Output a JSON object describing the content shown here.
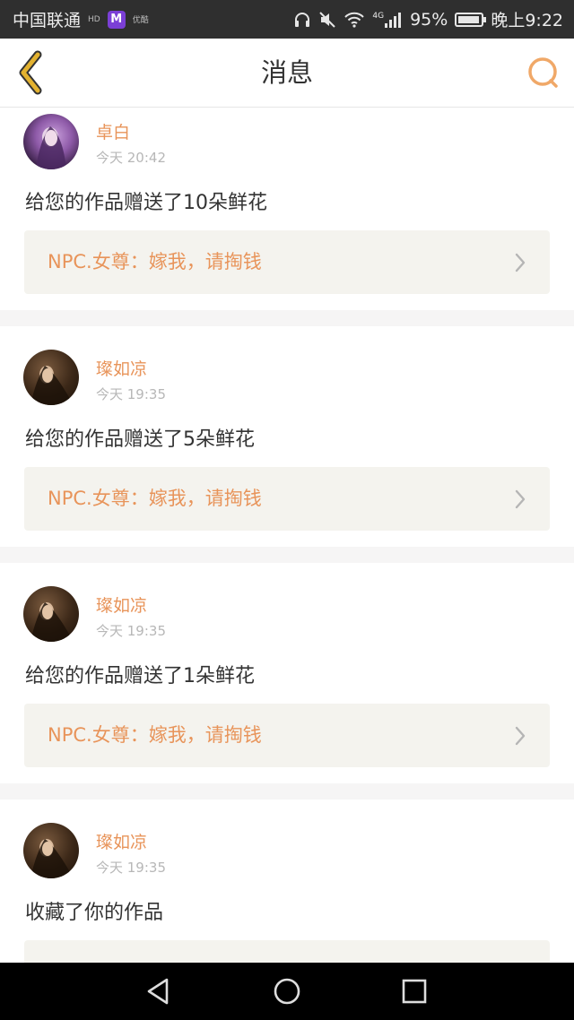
{
  "status_bar": {
    "carrier": "中国联通",
    "badges": [
      "HD",
      "优酷"
    ],
    "app_icon_letter": "M",
    "network": "4G",
    "battery": "95%",
    "battery_level": 0.95,
    "time": "晚上9:22"
  },
  "header": {
    "title": "消息",
    "back_icon": "chevron-left-icon",
    "search_icon": "search-icon"
  },
  "colors": {
    "accent": "#e8945a",
    "back_icon": "#e3b230",
    "quote_bg": "#f4f3ee"
  },
  "messages": [
    {
      "name": "卓白",
      "time": "今天 20:42",
      "text": "给您的作品赠送了10朵鲜花",
      "quote": "NPC.女尊：嫁我，请掏钱"
    },
    {
      "name": "璨如凉",
      "time": "今天 19:35",
      "text": "给您的作品赠送了5朵鲜花",
      "quote": "NPC.女尊：嫁我，请掏钱"
    },
    {
      "name": "璨如凉",
      "time": "今天 19:35",
      "text": "给您的作品赠送了1朵鲜花",
      "quote": "NPC.女尊：嫁我，请掏钱"
    },
    {
      "name": "璨如凉",
      "time": "今天 19:35",
      "text": "收藏了你的作品",
      "quote": ""
    }
  ],
  "system_nav": [
    "back-triangle-icon",
    "home-circle-icon",
    "recents-square-icon"
  ]
}
